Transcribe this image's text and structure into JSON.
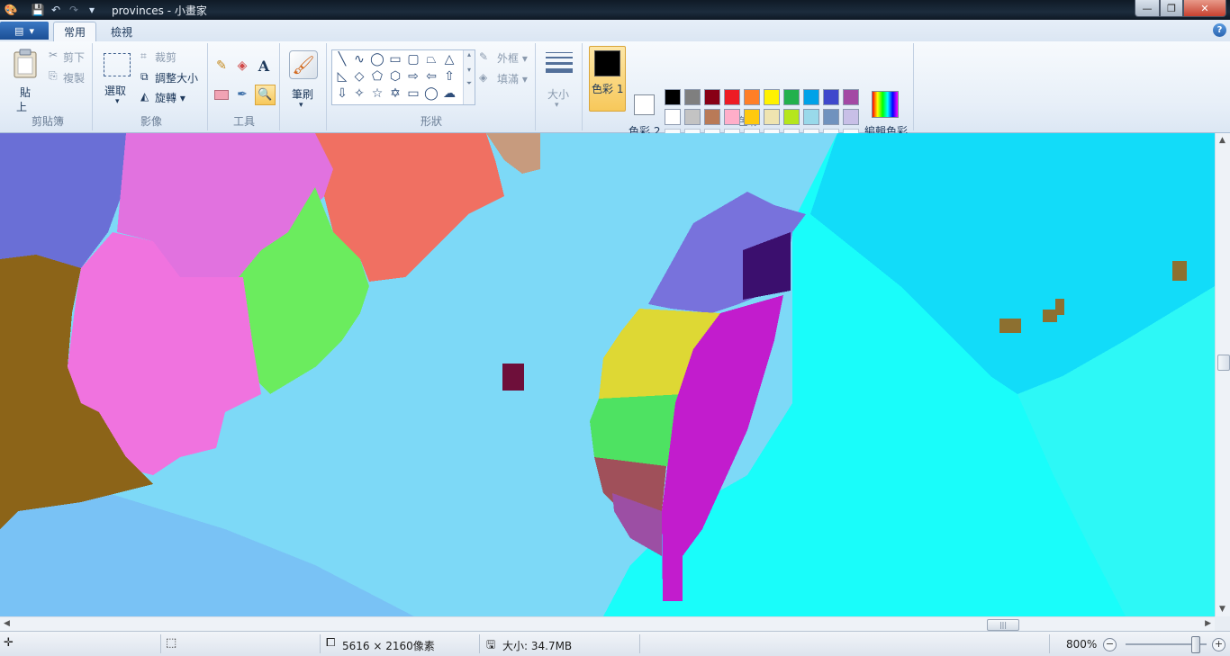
{
  "window": {
    "title": "provinces - 小畫家"
  },
  "tabs": [
    {
      "label": "常用"
    },
    {
      "label": "檢視"
    }
  ],
  "clipboard": {
    "paste": "貼",
    "paste2": "上",
    "cut": "剪下",
    "copy": "複製",
    "group": "剪貼簿"
  },
  "image": {
    "select": "選取",
    "crop": "裁剪",
    "resize": "調整大小",
    "rotate": "旋轉",
    "group": "影像"
  },
  "tools": {
    "group": "工具"
  },
  "brushes": {
    "label": "筆刷"
  },
  "shapes": {
    "outline": "外框",
    "fill": "填滿",
    "group": "形狀"
  },
  "size": {
    "label": "大小"
  },
  "colors": {
    "color1": "色彩 1",
    "color2": "色彩 2",
    "edit": "編輯色彩",
    "group": "色彩",
    "color1_value": "#000000",
    "color2_value": "#ffffff",
    "palette_row1": [
      "#000000",
      "#7f7f7f",
      "#880015",
      "#ed1c24",
      "#ff7f27",
      "#fff200",
      "#22b14c",
      "#00a2e8",
      "#3f48cc",
      "#a349a4"
    ],
    "palette_row2": [
      "#ffffff",
      "#c3c3c3",
      "#b97a57",
      "#ffaec9",
      "#ffc90e",
      "#efe4b0",
      "#b5e61d",
      "#99d9ea",
      "#7092be",
      "#c8bfe7"
    ]
  },
  "status": {
    "dimensions": "5616 × 2160像素",
    "size": "大小: 34.7MB",
    "zoom": "800%"
  }
}
